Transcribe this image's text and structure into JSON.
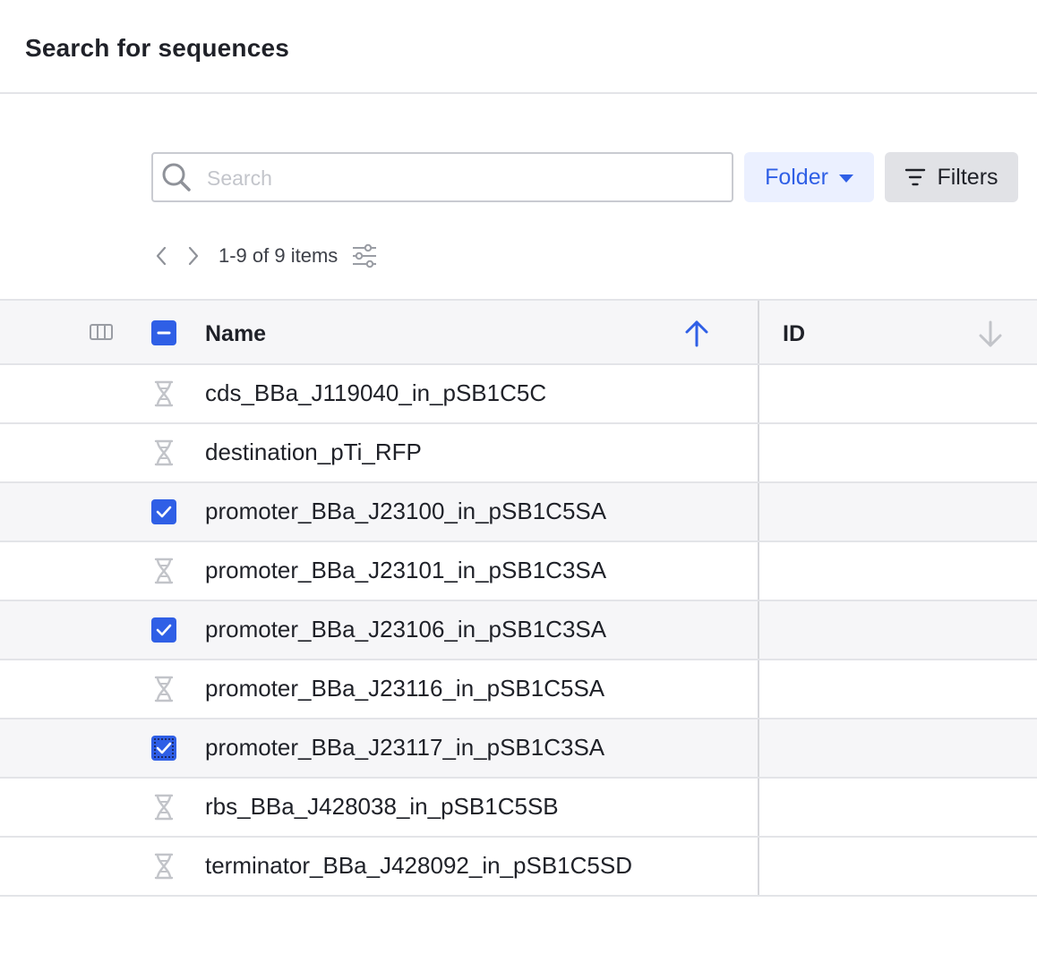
{
  "header": {
    "title": "Search for sequences"
  },
  "search": {
    "placeholder": "Search",
    "value": ""
  },
  "toolbar": {
    "folder_label": "Folder",
    "filters_label": "Filters"
  },
  "pager": {
    "count_label": "1-9 of 9 items"
  },
  "table": {
    "columns": [
      {
        "label": "Name",
        "sort": "ascending"
      },
      {
        "label": "ID",
        "sort": "none"
      }
    ],
    "select_all_state": "indeterminate",
    "rows": [
      {
        "name": "cds_BBa_J119040_in_pSB1C5C",
        "selected": false
      },
      {
        "name": "destination_pTi_RFP",
        "selected": false
      },
      {
        "name": "promoter_BBa_J23100_in_pSB1C5SA",
        "selected": true
      },
      {
        "name": "promoter_BBa_J23101_in_pSB1C3SA",
        "selected": false
      },
      {
        "name": "promoter_BBa_J23106_in_pSB1C3SA",
        "selected": true
      },
      {
        "name": "promoter_BBa_J23116_in_pSB1C5SA",
        "selected": false
      },
      {
        "name": "promoter_BBa_J23117_in_pSB1C3SA",
        "selected": true
      },
      {
        "name": "rbs_BBa_J428038_in_pSB1C5SB",
        "selected": false
      },
      {
        "name": "terminator_BBa_J428092_in_pSB1C5SD",
        "selected": false
      }
    ]
  },
  "icons": {
    "search": "search-icon",
    "folder_dropdown": "caret-down-icon",
    "filters": "filter-lines-icon",
    "prev": "chevron-left-icon",
    "next": "chevron-right-icon",
    "settings": "sliders-icon",
    "columns": "columns-icon",
    "sequence": "dna-icon",
    "sort_asc": "arrow-up-icon",
    "sort_desc": "arrow-down-icon"
  },
  "colors": {
    "accent": "#2f5fe6",
    "folder_bg": "#ebf0ff",
    "filters_bg": "#e1e2e6",
    "header_row_bg": "#f6f6f8",
    "selected_row_bg": "#f6f6f8",
    "border": "#e3e4e8",
    "icon_gray": "#c2c4c9"
  }
}
